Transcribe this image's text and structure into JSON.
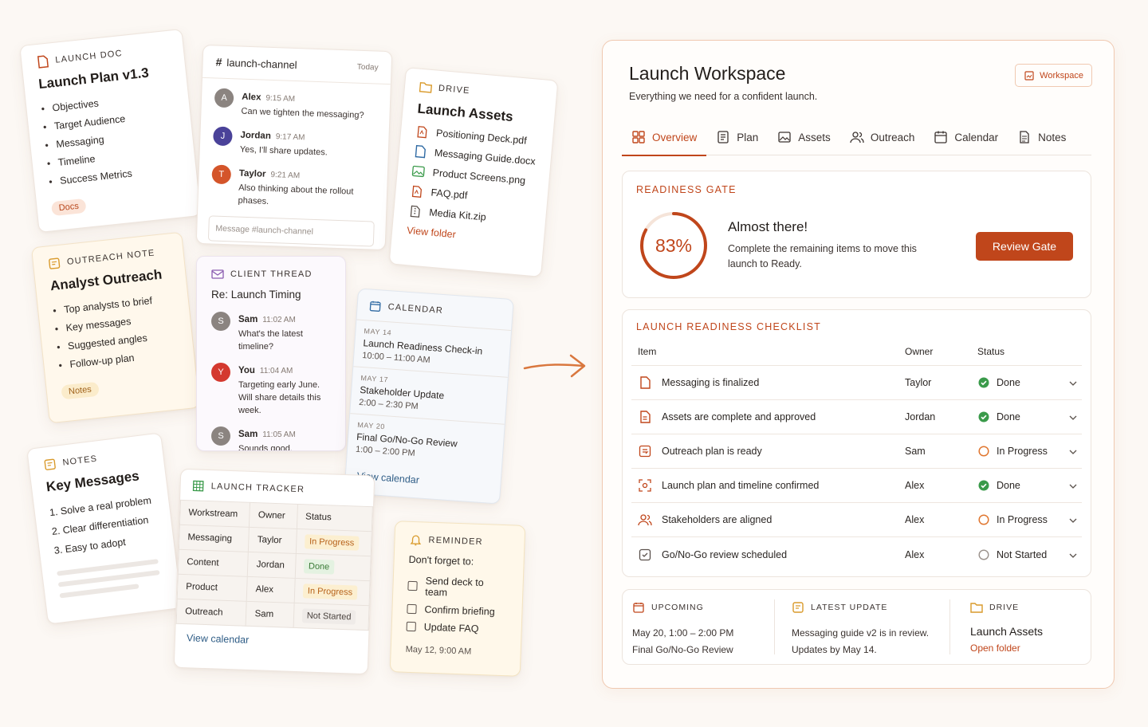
{
  "colors": {
    "accent": "#c0461b",
    "done": "#3a9a4a",
    "progress": "#e0762f",
    "not_started": "#9a918b"
  },
  "launch_doc": {
    "label": "LAUNCH DOC",
    "title": "Launch Plan v1.3",
    "items": [
      "Objectives",
      "Target Audience",
      "Messaging",
      "Timeline",
      "Success Metrics"
    ],
    "tag": "Docs"
  },
  "chat": {
    "channel": "launch-channel",
    "day": "Today",
    "messages": [
      {
        "initial": "A",
        "name": "Alex",
        "time": "9:15 AM",
        "text": "Can we tighten the messaging?",
        "color": "#8b8480"
      },
      {
        "initial": "J",
        "name": "Jordan",
        "time": "9:17 AM",
        "text": "Yes, I'll share updates.",
        "color": "#4a4299"
      },
      {
        "initial": "T",
        "name": "Taylor",
        "time": "9:21 AM",
        "text": "Also thinking about the rollout phases.",
        "color": "#d4552a"
      }
    ],
    "placeholder": "Message #launch-channel"
  },
  "drive_card": {
    "label": "DRIVE",
    "title": "Launch Assets",
    "files": [
      {
        "name": "Positioning Deck.pdf",
        "icon": "pdf-icon"
      },
      {
        "name": "Messaging Guide.docx",
        "icon": "doc-icon"
      },
      {
        "name": "Product Screens.png",
        "icon": "image-icon"
      },
      {
        "name": "FAQ.pdf",
        "icon": "pdf-icon"
      },
      {
        "name": "Media Kit.zip",
        "icon": "zip-icon"
      }
    ],
    "link": "View folder"
  },
  "outreach_note": {
    "label": "OUTREACH NOTE",
    "title": "Analyst Outreach",
    "items": [
      "Top analysts to brief",
      "Key messages",
      "Suggested angles",
      "Follow-up plan"
    ],
    "tag": "Notes"
  },
  "client_thread": {
    "label": "CLIENT THREAD",
    "title": "Re: Launch Timing",
    "messages": [
      {
        "initial": "S",
        "name": "Sam",
        "time": "11:02 AM",
        "text": "What's the latest timeline?",
        "color": "#8b8480"
      },
      {
        "initial": "Y",
        "name": "You",
        "time": "11:04 AM",
        "text": "Targeting early June. Will share details this week.",
        "color": "#d4392f"
      },
      {
        "initial": "S",
        "name": "Sam",
        "time": "11:05 AM",
        "text": "Sounds good.",
        "color": "#8b8480"
      }
    ]
  },
  "calendar_card": {
    "label": "CALENDAR",
    "events": [
      {
        "date": "MAY 14",
        "name": "Launch Readiness Check-in",
        "time": "10:00 – 11:00 AM"
      },
      {
        "date": "MAY 17",
        "name": "Stakeholder Update",
        "time": "2:00 – 2:30 PM"
      },
      {
        "date": "MAY 20",
        "name": "Final Go/No-Go Review",
        "time": "1:00 – 2:00 PM"
      }
    ],
    "link": "View calendar"
  },
  "notes_card": {
    "label": "NOTES",
    "title": "Key Messages",
    "items": [
      "1.  Solve a real problem",
      "2.  Clear differentiation",
      "3.  Easy to adopt"
    ]
  },
  "tracker": {
    "label": "LAUNCH TRACKER",
    "headers": [
      "Workstream",
      "Owner",
      "Status"
    ],
    "rows": [
      [
        "Messaging",
        "Taylor",
        "In Progress"
      ],
      [
        "Content",
        "Jordan",
        "Done"
      ],
      [
        "Product",
        "Alex",
        "In Progress"
      ],
      [
        "Outreach",
        "Sam",
        "Not Started"
      ]
    ],
    "link": "View calendar"
  },
  "reminder": {
    "label": "REMINDER",
    "intro": "Don't forget to:",
    "items": [
      "Send deck to team",
      "Confirm briefing",
      "Update FAQ"
    ],
    "date": "May 12, 9:00 AM"
  },
  "workspace": {
    "title": "Launch Workspace",
    "subtitle": "Everything we need for a confident launch.",
    "badge": "Workspace",
    "tabs": [
      {
        "label": "Overview",
        "icon": "grid-icon"
      },
      {
        "label": "Plan",
        "icon": "plan-icon"
      },
      {
        "label": "Assets",
        "icon": "image-icon"
      },
      {
        "label": "Outreach",
        "icon": "people-icon"
      },
      {
        "label": "Calendar",
        "icon": "calendar-icon"
      },
      {
        "label": "Notes",
        "icon": "notes-icon"
      }
    ],
    "gate": {
      "label": "READINESS GATE",
      "percent_text": "83%",
      "percent": 0.83,
      "heading": "Almost there!",
      "text": "Complete the remaining items to move this launch to Ready.",
      "button": "Review Gate"
    },
    "checklist": {
      "label": "LAUNCH READINESS CHECKLIST",
      "headers": [
        "Item",
        "Owner",
        "Status"
      ],
      "rows": [
        {
          "item": "Messaging is finalized",
          "owner": "Taylor",
          "status": "Done",
          "icon": "doc-icon"
        },
        {
          "item": "Assets are complete and approved",
          "owner": "Jordan",
          "status": "Done",
          "icon": "doc-lines-icon"
        },
        {
          "item": "Outreach plan is ready",
          "owner": "Sam",
          "status": "In Progress",
          "icon": "outreach-icon"
        },
        {
          "item": "Launch plan and timeline confirmed",
          "owner": "Alex",
          "status": "Done",
          "icon": "focus-icon"
        },
        {
          "item": "Stakeholders are aligned",
          "owner": "Alex",
          "status": "In Progress",
          "icon": "people-icon"
        },
        {
          "item": "Go/No-Go review scheduled",
          "owner": "Alex",
          "status": "Not Started",
          "icon": "check-doc-icon"
        }
      ]
    },
    "footer": {
      "upcoming": {
        "label": "UPCOMING",
        "line1": "May 20, 1:00 – 2:00 PM",
        "line2": "Final Go/No-Go Review"
      },
      "update": {
        "label": "LATEST UPDATE",
        "line1": "Messaging guide v2 is in review.",
        "line2": "Updates by May 14."
      },
      "drive": {
        "label": "DRIVE",
        "title": "Launch Assets",
        "link": "Open folder"
      }
    }
  }
}
